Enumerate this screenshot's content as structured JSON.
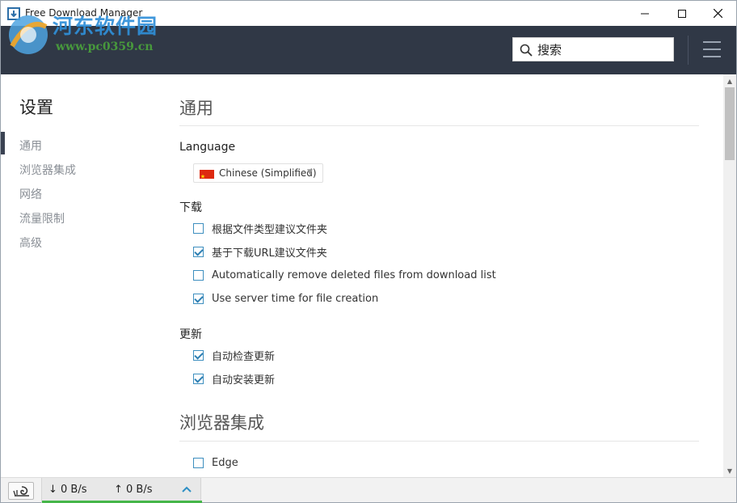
{
  "window": {
    "title": "Free Download Manager"
  },
  "watermark": {
    "name": "河东软件园",
    "url": "www.pc0359.cn"
  },
  "header": {
    "search_placeholder": "搜索"
  },
  "sidebar": {
    "title": "设置",
    "items": [
      {
        "label": "通用",
        "active": true
      },
      {
        "label": "浏览器集成"
      },
      {
        "label": "网络"
      },
      {
        "label": "流量限制"
      },
      {
        "label": "高级"
      }
    ]
  },
  "content": {
    "general": {
      "title": "通用",
      "language_label": "Language",
      "language_value": "Chinese (Simplified)",
      "download_label": "下载",
      "download_options": [
        {
          "label": "根据文件类型建议文件夹",
          "checked": false
        },
        {
          "label": "基于下载URL建议文件夹",
          "checked": true
        },
        {
          "label": "Automatically remove deleted files from download list",
          "checked": false
        },
        {
          "label": "Use server time for file creation",
          "checked": true
        }
      ],
      "update_label": "更新",
      "update_options": [
        {
          "label": "自动检查更新",
          "checked": true
        },
        {
          "label": "自动安装更新",
          "checked": true
        }
      ]
    },
    "browser": {
      "title": "浏览器集成",
      "options": [
        {
          "label": "Edge",
          "checked": false
        }
      ]
    }
  },
  "statusbar": {
    "download_speed": "↓  0 B/s",
    "upload_speed": "↑  0 B/s"
  },
  "colors": {
    "header_bg": "#303846",
    "accent_green": "#45b649",
    "checkbox_blue": "#2d7fb3"
  }
}
